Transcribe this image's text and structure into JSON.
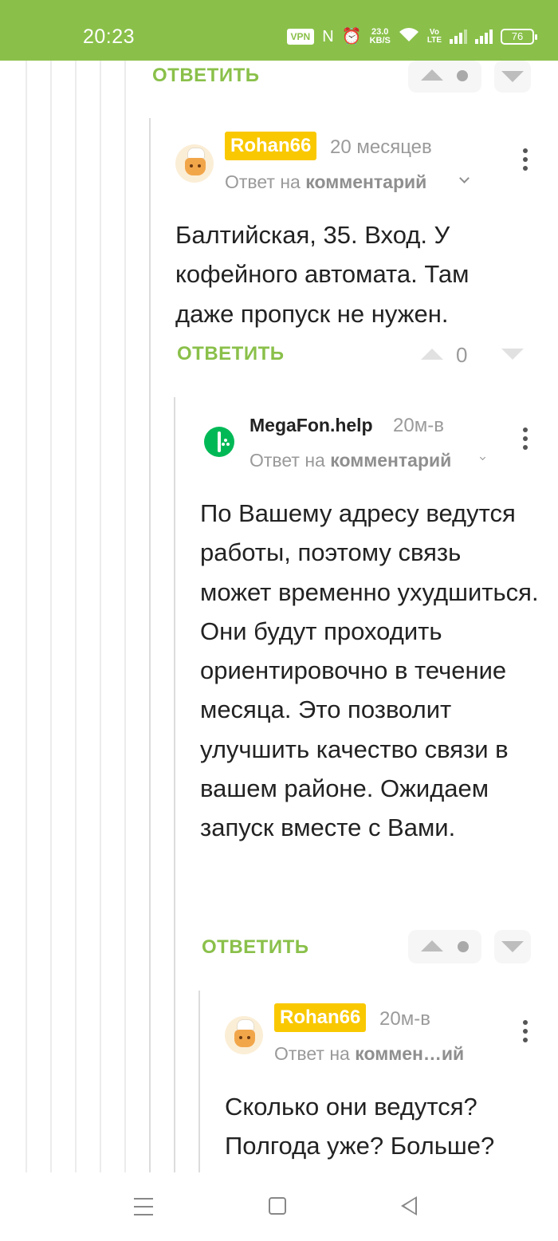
{
  "status_bar": {
    "time": "20:23",
    "vpn": "VPN",
    "nfc_glyph": "N",
    "alarm_glyph": "⏰",
    "speed_value": "23.0",
    "speed_unit": "KB/S",
    "volte_top": "Vo",
    "volte_bottom": "LTE",
    "battery": "76"
  },
  "actions": {
    "reply_label": "ОТВЕТИТЬ"
  },
  "top_vote": {
    "score": ""
  },
  "comments": [
    {
      "author": "Rohan66",
      "age": "20 месяцев",
      "reply_prefix": "Ответ на",
      "reply_target": "комментарий",
      "text": "Балтийская, 35. Вход. У кофейного автомата. Там даже пропуск не нужен.",
      "score": "0"
    },
    {
      "author": "MegaFon.help",
      "age": "20м-в",
      "reply_prefix": "Ответ на",
      "reply_target": "комментарий",
      "text": "По Вашему адресу ведутся работы, поэтому связь может временно ухудшиться. Они будут проходить ориентировочно в течение месяца. Это позволит улучшить качество связи в вашем районе. Ожидаем запуск вместе с Вами.",
      "score": ""
    },
    {
      "author": "Rohan66",
      "age": "20м-в",
      "reply_prefix": "Ответ на",
      "reply_target": "коммен…ий",
      "text": "Сколько они ведутся? Полгода уже? Больше?"
    }
  ]
}
